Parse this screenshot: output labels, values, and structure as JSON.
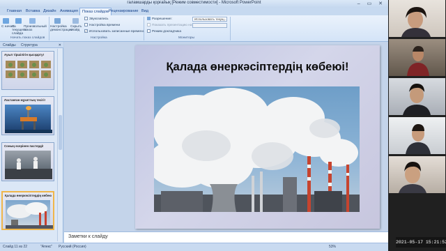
{
  "window": {
    "title": "галамшарды қорғайық [Режим совместимости] - Microsoft PowerPoint",
    "controls": "–  ▭  ✕"
  },
  "ribbon": {
    "tabs": [
      "Главная",
      "Вставка",
      "Дизайн",
      "Анимация",
      "Показ слайдов",
      "Рецензирование",
      "Вид"
    ],
    "active_tab": "Показ слайдов",
    "start_group": {
      "label": "Начать показ слайдов",
      "btn_from_start": "С начала",
      "btn_from_current": "С текущего слайда",
      "btn_custom": "Произвольный показ"
    },
    "setup_group": {
      "label": "Настройка",
      "btn_setup": "Настройка демонстрации",
      "btn_hide": "Скрыть слайд",
      "record": "Звукозапись",
      "rehearse": "Настройка времени",
      "use_timings": "Использовать записанные времена"
    },
    "monitors_group": {
      "label": "Мониторы",
      "resolution_label": "Разрешение:",
      "resolution_value": "Использовать текущ...",
      "show_on_label": "Показать презентацию на:",
      "presenter_view": "Режим докладчика"
    }
  },
  "left_panel": {
    "tab_slides": "Слайды",
    "tab_outline": "Структура",
    "close": "✕",
    "thumbnails": [
      {
        "title": "Ауыл тіршілігін қысқарту!"
      },
      {
        "title": "Ластанған мұхиттың тесігі!"
      },
      {
        "title": "Соның әсерінен пастерді!"
      },
      {
        "title": "Қалада өнеркәсіптердің көбеюі!"
      }
    ]
  },
  "slide": {
    "title": "Қалада өнеркәсіптердің көбеюі!"
  },
  "notes": {
    "placeholder": "Заметки к слайду"
  },
  "status": {
    "slide_counter": "Слайд 11 из 22",
    "theme": "\"Апекс\"",
    "language": "Русский (Россия)",
    "zoom": "53%"
  },
  "clock": "2021-05-17  15:21:52",
  "colors": {
    "accent": "#f0b64a",
    "ribbon_bg": "#dae7f6",
    "app_bg": "#b9cfe8"
  }
}
